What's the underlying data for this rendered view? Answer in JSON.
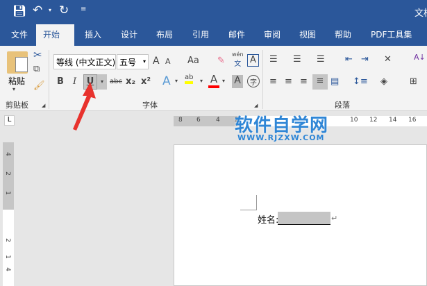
{
  "titlebar": {
    "title": "文档",
    "quick_access": [
      "save-icon",
      "undo-icon",
      "redo-icon",
      "customize-icon"
    ]
  },
  "tabs": [
    "文件",
    "开始",
    "插入",
    "设计",
    "布局",
    "引用",
    "邮件",
    "审阅",
    "视图",
    "帮助",
    "PDF工具集"
  ],
  "clipboard": {
    "paste": "粘贴",
    "group": "剪贴板"
  },
  "font": {
    "name": "等线 (中文正文)",
    "size": "五号",
    "group": "字体",
    "bold": "B",
    "italic": "I",
    "underline": "U",
    "strike": "abc",
    "sub": "x₂",
    "sup": "x²",
    "grow": "A",
    "shrink": "A",
    "case": "Aa",
    "phonetic": "wén",
    "phonetic_char": "文",
    "border": "A",
    "effects": "A",
    "highlight": "ab",
    "color": "A",
    "shading": "A",
    "enclose": "字"
  },
  "paragraph": {
    "group": "段落"
  },
  "colors": {
    "accent": "#2b579a",
    "highlight": "#ffff00",
    "font_color": "#ff0000",
    "arrow": "#e8322d"
  },
  "ruler": {
    "left": [
      "8",
      "6",
      "4",
      "2"
    ],
    "right": [
      "10",
      "12",
      "14",
      "16"
    ],
    "vertical": [
      "4",
      "2",
      "1",
      "2",
      "1",
      "4"
    ]
  },
  "watermark": {
    "name": "软件自学网",
    "url": "WWW.RJZXW.COM"
  },
  "document": {
    "label": "姓名:",
    "return_mark": "↵"
  }
}
